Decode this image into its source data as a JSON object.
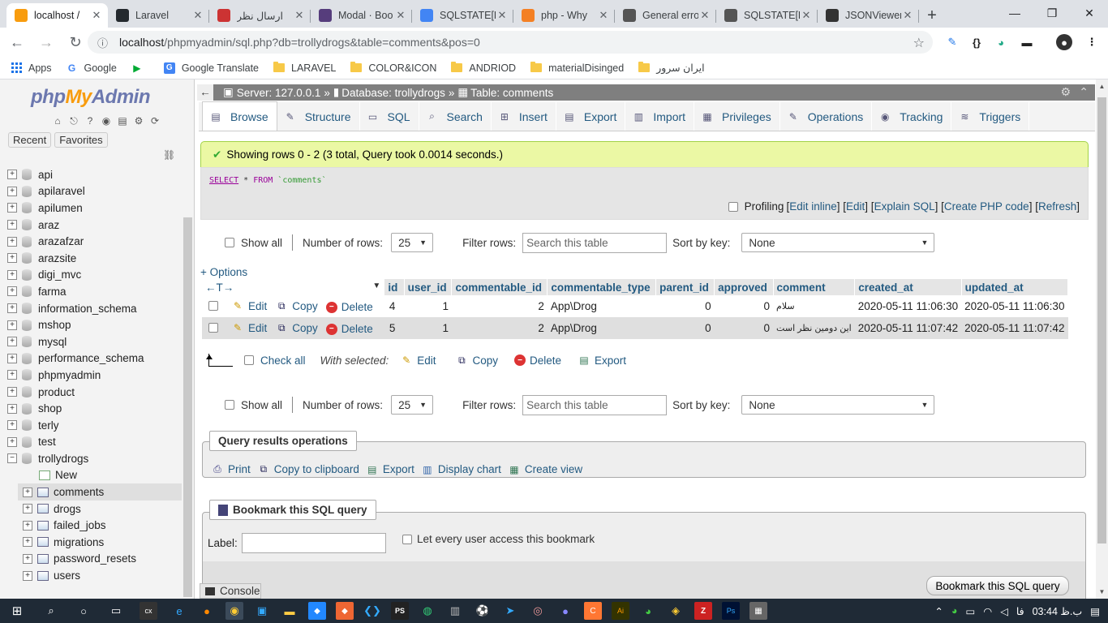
{
  "browser": {
    "tabs": [
      {
        "title": "localhost /",
        "icon": "phpmyadmin-icon",
        "color": "#f89c0e",
        "active": true
      },
      {
        "title": "Laravel",
        "icon": "github-icon",
        "color": "#24292e"
      },
      {
        "title": "ارسال نظر",
        "icon": "r-icon",
        "color": "#c33"
      },
      {
        "title": "Modal · Boo",
        "icon": "bootstrap-icon",
        "color": "#563d7c"
      },
      {
        "title": "SQLSTATE[H",
        "icon": "google-icon",
        "color": "#4285f4"
      },
      {
        "title": "php - Why",
        "icon": "stackoverflow-icon",
        "color": "#f48024"
      },
      {
        "title": "General erro",
        "icon": "send-icon",
        "color": "#555"
      },
      {
        "title": "SQLSTATE[H",
        "icon": "send-icon",
        "color": "#555"
      },
      {
        "title": "JSONViewer",
        "icon": "braces-icon",
        "color": "#333"
      }
    ],
    "url_host": "localhost",
    "url_path": "/phpmyadmin/sql.php?db=trollydrogs&table=comments&pos=0",
    "bookmarks": [
      {
        "label": "Apps",
        "type": "apps"
      },
      {
        "label": "Google",
        "type": "google"
      },
      {
        "label": "",
        "type": "play"
      },
      {
        "label": "Google Translate",
        "type": "translate"
      },
      {
        "label": "LARAVEL",
        "type": "folder"
      },
      {
        "label": "COLOR&ICON",
        "type": "folder"
      },
      {
        "label": "ANDRIOD",
        "type": "folder"
      },
      {
        "label": "materialDisinged",
        "type": "folder"
      },
      {
        "label": "ایران سرور",
        "type": "folder"
      }
    ]
  },
  "sidebar": {
    "logo_php": "php",
    "logo_my": "My",
    "logo_admin": "Admin",
    "recent": "Recent",
    "favorites": "Favorites",
    "databases": [
      "api",
      "apilaravel",
      "apilumen",
      "araz",
      "arazafzar",
      "arazsite",
      "digi_mvc",
      "farma",
      "information_schema",
      "mshop",
      "mysql",
      "performance_schema",
      "phpmyadmin",
      "product",
      "shop",
      "terly",
      "test",
      "trollydrogs"
    ],
    "expanded_db": "trollydrogs",
    "new_label": "New",
    "tables": [
      "comments",
      "drogs",
      "failed_jobs",
      "migrations",
      "password_resets",
      "users"
    ],
    "selected_table": "comments"
  },
  "breadcrumb": {
    "server": "Server: 127.0.0.1",
    "database": "Database: trollydrogs",
    "table": "Table: comments",
    "sep": "»"
  },
  "menu": [
    "Browse",
    "Structure",
    "SQL",
    "Search",
    "Insert",
    "Export",
    "Import",
    "Privileges",
    "Operations",
    "Tracking",
    "Triggers"
  ],
  "success_message": "Showing rows 0 - 2 (3 total, Query took 0.0014 seconds.)",
  "sql": {
    "kw1": "SELECT",
    "mid": " * ",
    "kw2": "FROM",
    "table": " `comments`"
  },
  "profiling": {
    "label": "Profiling",
    "links": [
      "Edit inline",
      "Edit",
      "Explain SQL",
      "Create PHP code",
      "Refresh"
    ]
  },
  "nav": {
    "show_all": "Show all",
    "number_of_rows": "Number of rows:",
    "rows_value": "25",
    "filter_rows": "Filter rows:",
    "filter_placeholder": "Search this table",
    "sort_by_key": "Sort by key:",
    "sort_value": "None"
  },
  "options_label": "+ Options",
  "table": {
    "columns": [
      "id",
      "user_id",
      "commentable_id",
      "commentable_type",
      "parent_id",
      "approved",
      "comment",
      "created_at",
      "updated_at"
    ],
    "action_edit": "Edit",
    "action_copy": "Copy",
    "action_delete": "Delete",
    "rows": [
      {
        "id": "4",
        "user_id": "1",
        "commentable_id": "2",
        "commentable_type": "App\\Drog",
        "parent_id": "0",
        "approved": "0",
        "comment": "سلام",
        "created_at": "2020-05-11 11:06:30",
        "updated_at": "2020-05-11 11:06:30"
      },
      {
        "id": "5",
        "user_id": "1",
        "commentable_id": "2",
        "commentable_type": "App\\Drog",
        "parent_id": "0",
        "approved": "0",
        "comment": "این دومین نظر است",
        "created_at": "2020-05-11 11:07:42",
        "updated_at": "2020-05-11 11:07:42"
      }
    ]
  },
  "bulk": {
    "check_all": "Check all",
    "with_selected": "With selected:",
    "edit": "Edit",
    "copy": "Copy",
    "delete": "Delete",
    "export": "Export"
  },
  "query_ops": {
    "legend": "Query results operations",
    "print": "Print",
    "copy_clipboard": "Copy to clipboard",
    "export": "Export",
    "display_chart": "Display chart",
    "create_view": "Create view"
  },
  "bookmark": {
    "legend": "Bookmark this SQL query",
    "label": "Label:",
    "let_every_user": "Let every user access this bookmark",
    "button": "Bookmark this SQL query"
  },
  "console": "Console",
  "taskbar": {
    "time": "03:44 ب.ظ",
    "lang": "فا"
  }
}
